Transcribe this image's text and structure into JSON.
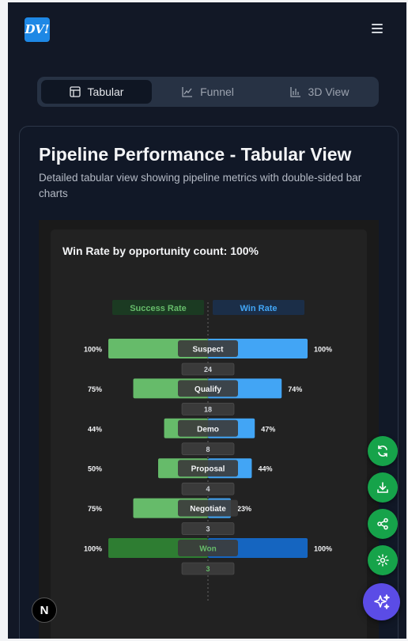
{
  "header": {
    "logo_text": "DV!",
    "menu_icon": "hamburger-menu-icon"
  },
  "tabs": [
    {
      "label": "Tabular",
      "icon": "table-icon",
      "active": true
    },
    {
      "label": "Funnel",
      "icon": "line-chart-icon",
      "active": false
    },
    {
      "label": "3D View",
      "icon": "bar-chart-icon",
      "active": false
    }
  ],
  "card": {
    "title": "Pipeline Performance - Tabular View",
    "description": "Detailed tabular view showing pipeline metrics with double-sided bar charts"
  },
  "chart_data": {
    "type": "bar",
    "title": "Win Rate by opportunity count: 100%",
    "legend": {
      "left": "Success Rate",
      "right": "Win Rate"
    },
    "categories": [
      "Suspect",
      "Qualify",
      "Demo",
      "Proposal",
      "Negotiate",
      "Won"
    ],
    "series": [
      {
        "name": "Success Rate",
        "values": [
          100,
          75,
          44,
          50,
          75,
          100
        ]
      },
      {
        "name": "Win Rate",
        "values": [
          100,
          74,
          47,
          44,
          23,
          100
        ]
      }
    ],
    "counts": [
      24,
      18,
      8,
      4,
      3,
      3
    ],
    "xlim": [
      0,
      100
    ],
    "colors": {
      "success": "#66bb6a",
      "win": "#42a5f5",
      "success_final": "#2e7d32",
      "win_final": "#1565c0"
    }
  },
  "actions": [
    {
      "icon": "refresh-icon"
    },
    {
      "icon": "download-icon"
    },
    {
      "icon": "share-icon"
    },
    {
      "icon": "settings-icon"
    }
  ],
  "ai_button": {
    "icon": "sparkles-icon"
  },
  "dev_badge": {
    "letter": "N"
  }
}
